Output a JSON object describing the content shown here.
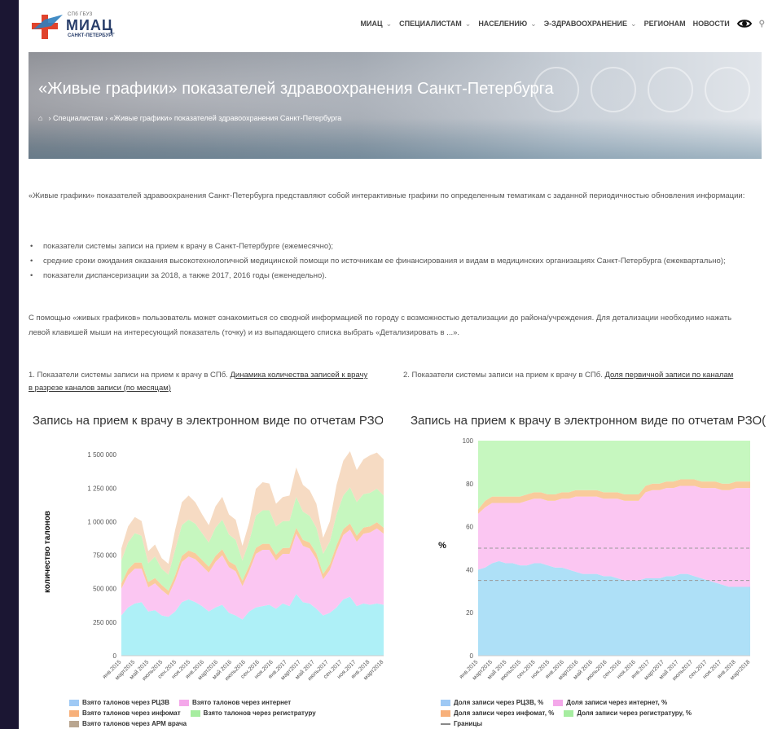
{
  "header": {
    "logo_small": "СПб ГБУЗ",
    "logo_big": "МИАЦ",
    "logo_sub": "САНКТ-ПЕТЕРБУРГ",
    "nav": [
      {
        "label": "МИАЦ",
        "dropdown": true
      },
      {
        "label": "СПЕЦИАЛИСТАМ",
        "dropdown": true
      },
      {
        "label": "НАСЕЛЕНИЮ",
        "dropdown": true
      },
      {
        "label": "Э-ЗДРАВООХРАНЕНИЕ",
        "dropdown": true
      },
      {
        "label": "РЕГИОНАМ",
        "dropdown": false
      },
      {
        "label": "НОВОСТИ",
        "dropdown": false
      }
    ],
    "icons": [
      "eye-icon",
      "search-icon"
    ]
  },
  "banner": {
    "title": "«Живые графики» показателей здравоохранения Санкт-Петербурга",
    "breadcrumb": [
      "Специалистам",
      "«Живые графики» показателей здравоохранения Санкт-Петербурга"
    ]
  },
  "intro": "«Живые графики» показателей здравоохранения Санкт-Петербурга представляют собой интерактивные графики по определенным тематикам с заданной периодичностью обновления информации:",
  "bullets": [
    "показатели системы записи на прием к врачу в Санкт-Петербурге (ежемесячно);",
    "средние сроки ожидания оказания высокотехнологичной медицинской помощи по источникам ее финансирования и видам в медицинских организациях Санкт-Петербурга (ежеквартально);",
    "показатели диспансеризации за 2018, а также 2017, 2016 годы (еженедельно)."
  ],
  "help": "С помощью «живых графиков» пользователь может ознакомиться со сводной информацией по городу с возможностью детализации до района/учреждения. Для детализации необходимо нажать левой клавишей мыши на интересующий показатель (точку) и  из выпадающего списка выбрать «Детализировать в ...».",
  "captions": [
    {
      "text": "1. Показатели системы записи на прием к врачу в СПб. ",
      "link": "Динамика количества записей к врачу в разрезе каналов записи (по месяцам)"
    },
    {
      "text": "2. Показатели системы записи на прием к врачу в СПб. ",
      "link": "Доля первичной записи по каналам"
    }
  ],
  "chart_data": [
    {
      "type": "area",
      "stacked": true,
      "title": "Запись на прием к врачу в электронном виде по отчетам РЗО",
      "ylabel": "количество талонов",
      "ylim": [
        0,
        1550000
      ],
      "yticks": [
        "0",
        "250 000",
        "500 000",
        "750 000",
        "1 000 000",
        "1 250 000",
        "1 500 000"
      ],
      "ytick_values": [
        0,
        250000,
        500000,
        750000,
        1000000,
        1250000,
        1500000
      ],
      "x_labels": [
        "янв.2015",
        "март2015",
        "май 2015",
        "июль2015",
        "сен.2015",
        "ноя.2015",
        "янв.2016",
        "март2016",
        "май 2016",
        "июль2016",
        "сен.2016",
        "ноя.2016",
        "янв.2017",
        "март2017",
        "май 2017",
        "июль2017",
        "сен.2017",
        "ноя.2017",
        "янв.2018",
        "март2018"
      ],
      "series": [
        {
          "name": "Взято талонов через РЦЗВ",
          "color": "#aef0f7",
          "values": [
            300000,
            360000,
            390000,
            400000,
            330000,
            340000,
            300000,
            290000,
            330000,
            400000,
            420000,
            400000,
            370000,
            330000,
            360000,
            380000,
            320000,
            300000,
            270000,
            330000,
            360000,
            370000,
            380000,
            350000,
            390000,
            370000,
            460000,
            400000,
            390000,
            350000,
            300000,
            320000,
            360000,
            420000,
            440000,
            370000,
            390000,
            380000,
            390000,
            380000
          ]
        },
        {
          "name": "Взято талонов через интернет",
          "color": "#fbc6f2",
          "values": [
            200000,
            240000,
            260000,
            250000,
            180000,
            200000,
            190000,
            160000,
            230000,
            300000,
            320000,
            320000,
            300000,
            290000,
            340000,
            370000,
            340000,
            330000,
            250000,
            300000,
            400000,
            420000,
            410000,
            360000,
            370000,
            390000,
            450000,
            420000,
            410000,
            370000,
            270000,
            320000,
            420000,
            480000,
            500000,
            480000,
            520000,
            540000,
            560000,
            530000
          ]
        },
        {
          "name": "Взято талонов через инфомат",
          "color": "#f9cb9c",
          "values": [
            40000,
            45000,
            45000,
            45000,
            40000,
            40000,
            38000,
            35000,
            40000,
            45000,
            45000,
            45000,
            45000,
            44000,
            45000,
            45000,
            44000,
            44000,
            40000,
            42000,
            45000,
            45000,
            45000,
            44000,
            44000,
            45000,
            45000,
            45000,
            44000,
            44000,
            40000,
            42000,
            45000,
            45000,
            46000,
            46000,
            46000,
            46000,
            46000,
            45000
          ]
        },
        {
          "name": "Взято талонов через регистратуру",
          "color": "#c6f7bf",
          "values": [
            170000,
            200000,
            220000,
            200000,
            140000,
            160000,
            120000,
            120000,
            190000,
            230000,
            230000,
            220000,
            200000,
            180000,
            210000,
            220000,
            200000,
            190000,
            150000,
            180000,
            240000,
            250000,
            250000,
            210000,
            200000,
            200000,
            230000,
            210000,
            200000,
            190000,
            150000,
            170000,
            230000,
            250000,
            270000,
            250000,
            250000,
            250000,
            250000,
            240000
          ]
        },
        {
          "name": "Взято талонов через АРМ врача",
          "color": "#f6dbc3",
          "values": [
            90000,
            120000,
            120000,
            110000,
            90000,
            90000,
            80000,
            80000,
            150000,
            170000,
            180000,
            160000,
            140000,
            130000,
            160000,
            170000,
            150000,
            150000,
            110000,
            140000,
            200000,
            210000,
            200000,
            170000,
            180000,
            190000,
            220000,
            200000,
            190000,
            180000,
            120000,
            150000,
            220000,
            260000,
            270000,
            240000,
            260000,
            280000,
            270000,
            270000
          ]
        }
      ]
    },
    {
      "type": "area",
      "stacked": true,
      "percent": true,
      "title": "Запись на прием к врачу в электронном виде по отчетам РЗО(...",
      "ylabel": "%",
      "ylim": [
        0,
        100
      ],
      "yticks": [
        "0",
        "20",
        "40",
        "60",
        "80",
        "100"
      ],
      "ytick_values": [
        0,
        20,
        40,
        60,
        80,
        100
      ],
      "x_labels": [
        "янв.2015",
        "март2015",
        "май 2015",
        "июль2015",
        "сен.2015",
        "ноя.2015",
        "янв.2016",
        "март2016",
        "май 2016",
        "июль2016",
        "сен.2016",
        "ноя.2016",
        "янв.2017",
        "март2017",
        "май 2017",
        "июль2017",
        "сен.2017",
        "ноя.2017",
        "янв.2018",
        "март2018"
      ],
      "series": [
        {
          "name": "Доля записи через РЦЗВ, %",
          "color": "#aee0f7",
          "values": [
            40,
            41,
            43,
            44,
            43,
            43,
            42,
            42,
            43,
            43,
            42,
            41,
            41,
            40,
            39,
            38,
            38,
            38,
            37,
            37,
            36,
            35,
            35,
            35,
            36,
            36,
            36,
            37,
            37,
            38,
            38,
            37,
            36,
            35,
            34,
            33,
            32,
            32,
            32,
            32
          ]
        },
        {
          "name": "Доля записи через интернет, %",
          "color": "#fbc6f2",
          "values": [
            26,
            28,
            28,
            27,
            28,
            28,
            29,
            30,
            30,
            30,
            30,
            31,
            32,
            33,
            35,
            36,
            36,
            36,
            36,
            36,
            37,
            37,
            37,
            37,
            40,
            41,
            41,
            41,
            41,
            41,
            41,
            42,
            42,
            43,
            44,
            44,
            45,
            46,
            46,
            46
          ]
        },
        {
          "name": "Доля записи через инфомат, %",
          "color": "#f9cb9c",
          "values": [
            2,
            3,
            3,
            3,
            3,
            3,
            3,
            3,
            3,
            3,
            3,
            3,
            3,
            3,
            3,
            3,
            3,
            3,
            3,
            3,
            3,
            3,
            3,
            3,
            3,
            3,
            3,
            3,
            3,
            3,
            3,
            3,
            3,
            3,
            3,
            3,
            3,
            3,
            3,
            3
          ]
        },
        {
          "name": "Доля записи через регистратуру, %",
          "color": "#c6f7bf",
          "values": [
            32,
            28,
            26,
            26,
            26,
            26,
            26,
            25,
            24,
            24,
            25,
            25,
            24,
            24,
            23,
            23,
            23,
            23,
            24,
            24,
            24,
            25,
            25,
            25,
            21,
            20,
            20,
            19,
            19,
            18,
            18,
            18,
            19,
            19,
            19,
            20,
            20,
            19,
            19,
            19
          ]
        }
      ],
      "boundaries": {
        "name": "Границы",
        "values": [
          50,
          35
        ]
      }
    }
  ],
  "legend1": [
    [
      "Взято талонов через РЦЗВ",
      "Взято талонов через интернет"
    ],
    [
      "Взято талонов через инфомат",
      "Взято талонов через регистратуру"
    ],
    [
      "Взято талонов через АРМ врача"
    ]
  ],
  "legend2": [
    [
      "Доля записи через РЦЗВ, %",
      "Доля записи через интернет, %"
    ],
    [
      "Доля записи через инфомат, %",
      "Доля записи через регистратуру, %"
    ],
    [
      "Границы"
    ]
  ]
}
